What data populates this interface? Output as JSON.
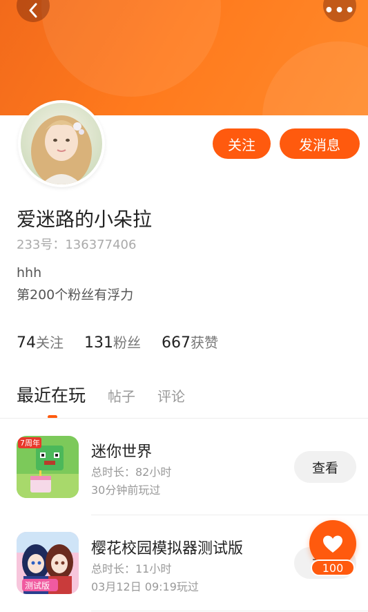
{
  "header": {
    "back_icon": "chevron-left-icon",
    "more_icon": "more-dots-icon",
    "more_glyph": "•••",
    "colors": {
      "brand": "#ff5a0e",
      "header_start": "#f26a1b",
      "header_end": "#ff8a2b"
    }
  },
  "profile": {
    "follow_label": "关注",
    "message_label": "发消息",
    "username": "爱迷路的小朵拉",
    "uid_text": "233号：136377406",
    "bio_line1": "hhh",
    "bio_line2": "第200个粉丝有浮力"
  },
  "stats": [
    {
      "value": "74",
      "label": "关注"
    },
    {
      "value": "131",
      "label": "粉丝"
    },
    {
      "value": "667",
      "label": "获赞"
    }
  ],
  "tabs": [
    {
      "label": "最近在玩",
      "active": true
    },
    {
      "label": "帖子",
      "active": false
    },
    {
      "label": "评论",
      "active": false
    }
  ],
  "games": [
    {
      "name": "迷你世界",
      "duration": "总时长：82小时",
      "last_played": "30分钟前玩过",
      "action": "查看",
      "icon": "mini-world-game-icon",
      "badge": "7周年"
    },
    {
      "name": "樱花校园模拟器测试版",
      "duration": "总时长：11小时",
      "last_played": "03月12日 09:19玩过",
      "action": "查看",
      "icon": "sakura-school-game-icon",
      "badge": "测试版"
    }
  ],
  "like": {
    "icon": "heart-icon",
    "count": "100"
  }
}
